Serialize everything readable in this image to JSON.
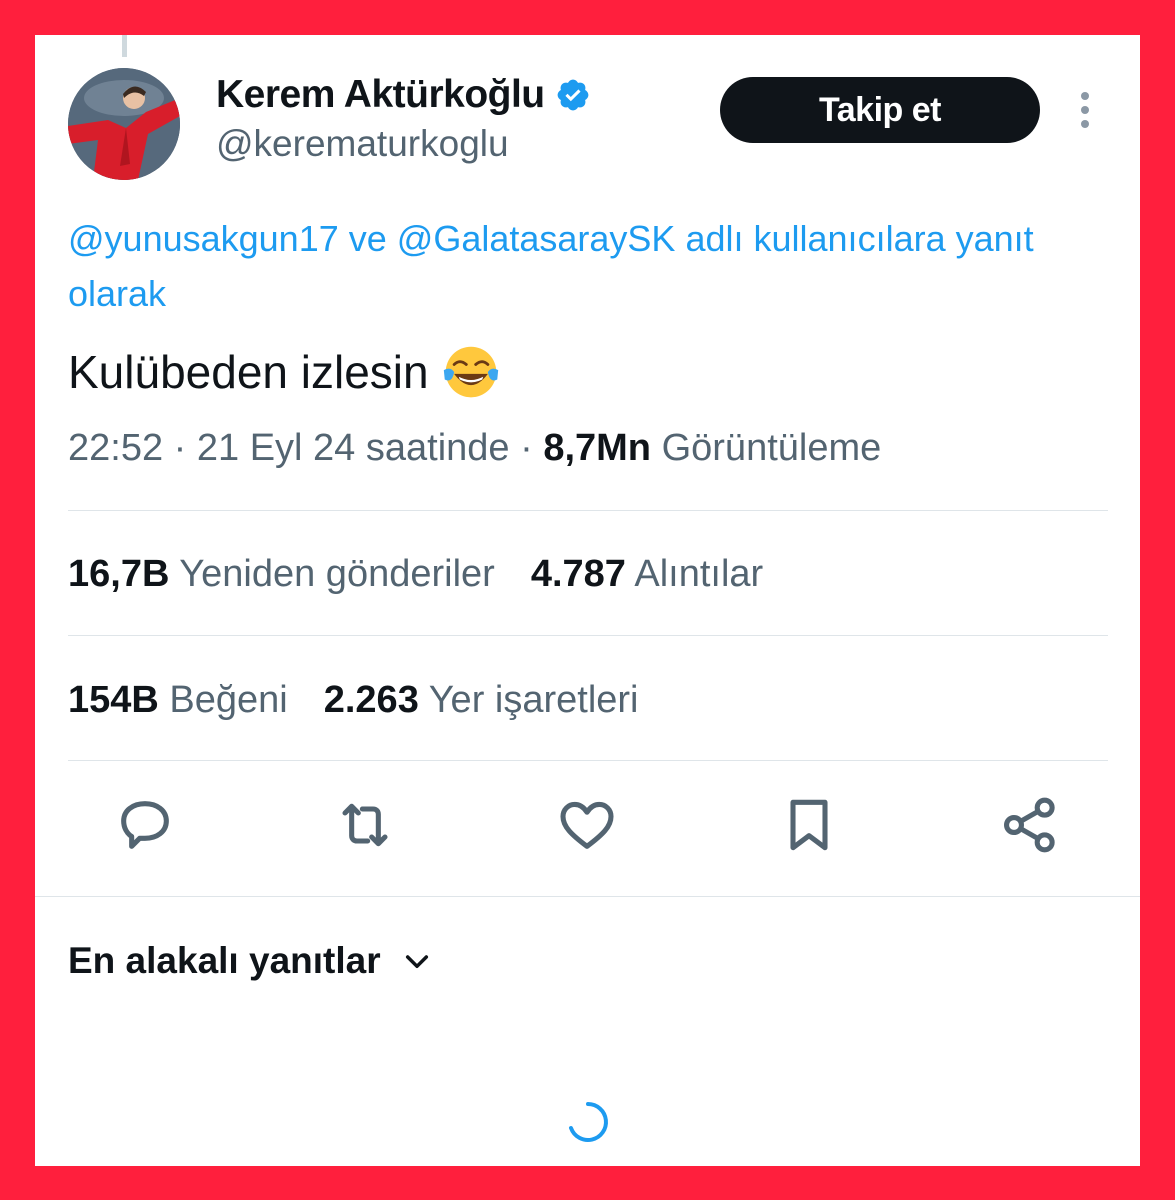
{
  "author": {
    "display_name": "Kerem Aktürkoğlu",
    "handle": "@kerematurkoglu",
    "avatar_icon": "profile-photo",
    "verified_icon": "verified-badge-icon"
  },
  "follow_button": {
    "label": "Takip et"
  },
  "reply_context": {
    "mention_1": "@yunusakgun17",
    "connector": " ve ",
    "mention_2": "@GalatasaraySK",
    "suffix": " adlı kullanıcılara yanıt olarak"
  },
  "tweet": {
    "text": "Kulübeden izlesin",
    "emoji_icon": "face-with-tears-of-joy-emoji"
  },
  "meta": {
    "time": "22:52",
    "sep1": " · ",
    "date": "21 Eyl 24 saatinde",
    "sep2": " · ",
    "views_count": "8,7Mn",
    "views_label": " Görüntüleme"
  },
  "stats": {
    "reposts_count": "16,7B",
    "reposts_label": " Yeniden gönderiler",
    "quotes_count": "4.787",
    "quotes_label": " Alıntılar",
    "likes_count": "154B",
    "likes_label": " Beğeni",
    "bookmarks_count": "2.263",
    "bookmarks_label": " Yer işaretleri"
  },
  "actions": [
    "reply-icon",
    "repost-icon",
    "like-icon",
    "bookmark-icon",
    "share-icon"
  ],
  "replies_sort": {
    "label": "En alakalı yanıtlar"
  },
  "colors": {
    "frame": "#ff1f3d",
    "link": "#1d9bf0",
    "text_primary": "#0f1419",
    "text_secondary": "#536471"
  }
}
